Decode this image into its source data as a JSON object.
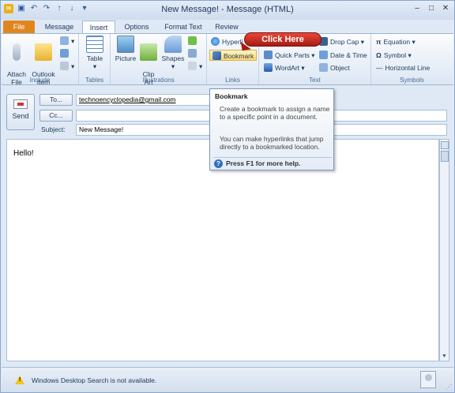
{
  "window": {
    "title": "New Message! - Message (HTML)",
    "controls": {
      "minimize": "–",
      "maximize": "□",
      "close": "✕"
    }
  },
  "quick_access": {
    "icons": [
      "outlook-app-icon",
      "save-icon",
      "undo-icon",
      "redo-icon",
      "up-arrow-icon",
      "down-arrow-icon",
      "customize-icon"
    ]
  },
  "tabs": [
    {
      "label": "File"
    },
    {
      "label": "Message"
    },
    {
      "label": "Insert"
    },
    {
      "label": "Options"
    },
    {
      "label": "Format Text"
    },
    {
      "label": "Review"
    }
  ],
  "active_tab": "Insert",
  "ribbon": {
    "groups": {
      "include": "Include",
      "tables": "Tables",
      "illustrations": "Illustrations",
      "links": "Links",
      "text": "Text",
      "symbols": "Symbols"
    },
    "buttons": {
      "attach_file": "Attach\nFile",
      "outlook_item": "Outlook\nItem",
      "table": "Table",
      "picture": "Picture",
      "clip_art": "Clip\nArt",
      "shapes": "Shapes",
      "hyperlink": "Hyperli",
      "bookmark": "Bookmark",
      "quick_parts": "Quick Parts",
      "wordart": "WordArt",
      "drop_cap": "Drop Cap",
      "date_time": "Date & Time",
      "object": "Object",
      "equation": "Equation",
      "symbol": "Symbol",
      "horizontal_line": "Horizontal Line"
    }
  },
  "callout": {
    "text": "Click Here"
  },
  "tooltip": {
    "title": "Bookmark",
    "line1": "Create a bookmark to assign a name to a specific point in a document.",
    "line2": "You can make hyperlinks that jump directly to a bookmarked location.",
    "help": "Press F1 for more help."
  },
  "compose": {
    "send": "Send",
    "to_button": "To...",
    "cc_button": "Cc...",
    "subject_label": "Subject:",
    "to_value": "technoencyclopedia@gmail.com",
    "cc_value": "",
    "subject_value": "New Message!",
    "body": "Hello!"
  },
  "status": {
    "message": "Windows Desktop Search is not available."
  },
  "colors": {
    "file_tab": "#e0861f",
    "callout": "#c8281d",
    "ribbon": "#dce7f4"
  }
}
